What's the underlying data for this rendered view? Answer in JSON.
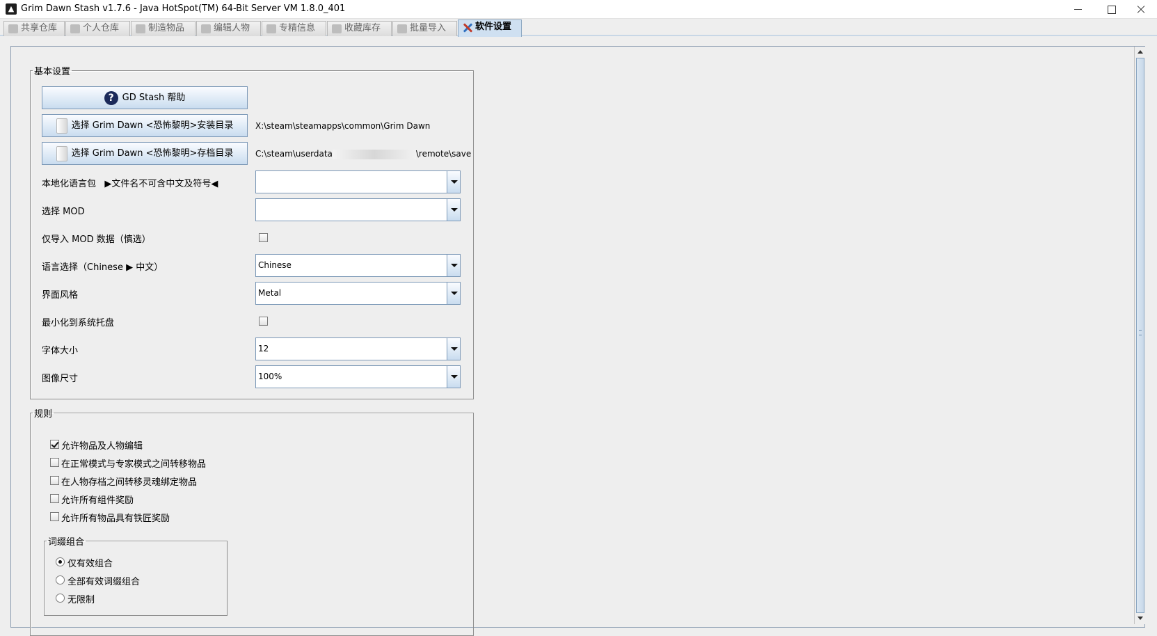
{
  "window": {
    "title": "Grim Dawn Stash v1.7.6 - Java HotSpot(TM) 64-Bit Server VM 1.8.0_401",
    "icon": "app-icon"
  },
  "tabs": [
    {
      "label": "共享仓库",
      "icon": "shared-stash-icon"
    },
    {
      "label": "个人仓库",
      "icon": "personal-stash-icon"
    },
    {
      "label": "制造物品",
      "icon": "craft-icon"
    },
    {
      "label": "编辑人物",
      "icon": "character-icon"
    },
    {
      "label": "专精信息",
      "icon": "mastery-icon"
    },
    {
      "label": "收藏库存",
      "icon": "collection-icon"
    },
    {
      "label": "批量导入",
      "icon": "import-icon"
    },
    {
      "label": "软件设置",
      "icon": "tools-icon",
      "active": true
    }
  ],
  "basic": {
    "legend": "基本设置",
    "help_button": "GD Stash 帮助",
    "help_mnemonic": "h",
    "install_dir_button": "选择 Grim Dawn <恐怖黎明>安装目录",
    "install_dir_path": "X:\\steam\\steamapps\\common\\Grim Dawn",
    "save_dir_button": "选择 Grim Dawn <恐怖黎明>存档目录",
    "save_dir_path_prefix": "C:\\steam\\userdata",
    "save_dir_path_suffix": "\\remote\\save",
    "localization_label": "本地化语言包",
    "localization_hint": "▶文件名不可含中文及符号◀",
    "localization_value": "",
    "mod_label": "选择 MOD",
    "mod_value": "",
    "mod_only_label": "仅导入 MOD 数据（慎选）",
    "mod_only_checked": false,
    "language_label": "语言选择（Chinese ▶ 中文）",
    "language_value": "Chinese",
    "style_label": "界面风格",
    "style_value": "Metal",
    "minimize_tray_label": "最小化到系统托盘",
    "minimize_tray_checked": false,
    "font_size_label": "字体大小",
    "font_size_value": "12",
    "image_size_label": "图像尺寸",
    "image_size_value": "100%"
  },
  "rules": {
    "legend": "规则",
    "items": [
      {
        "label": "允许物品及人物编辑",
        "checked": true
      },
      {
        "label": "在正常模式与专家模式之间转移物品",
        "checked": false
      },
      {
        "label": "在人物存档之间转移灵魂绑定物品",
        "checked": false
      },
      {
        "label": "允许所有组件奖励",
        "checked": false
      },
      {
        "label": "允许所有物品具有铁匠奖励",
        "checked": false
      }
    ],
    "affix": {
      "legend": "词缀组合",
      "options": [
        {
          "label": "仅有效组合",
          "selected": true
        },
        {
          "label": "全部有效词缀组合",
          "selected": false
        },
        {
          "label": "无限制",
          "selected": false
        }
      ]
    }
  }
}
